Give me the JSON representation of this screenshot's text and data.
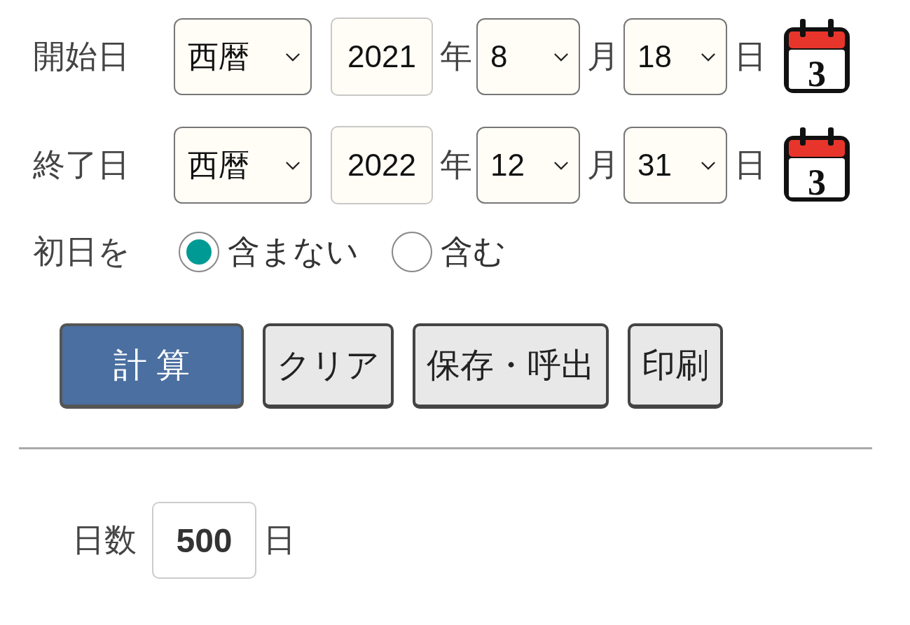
{
  "date_rows": [
    {
      "label": "開始日",
      "era": "西暦",
      "year": "2021",
      "year_unit": "年",
      "month": "8",
      "month_unit": "月",
      "day": "18",
      "day_unit": "日",
      "calendar_day": "3"
    },
    {
      "label": "終了日",
      "era": "西暦",
      "year": "2022",
      "year_unit": "年",
      "month": "12",
      "month_unit": "月",
      "day": "31",
      "day_unit": "日",
      "calendar_day": "3"
    }
  ],
  "first_day": {
    "label": "初日を",
    "options": [
      {
        "label": "含まない",
        "selected": true
      },
      {
        "label": "含む",
        "selected": false
      }
    ]
  },
  "buttons": [
    {
      "label": "計 算",
      "kind": "primary"
    },
    {
      "label": "クリア",
      "kind": "normal"
    },
    {
      "label": "保存・呼出",
      "kind": "normal"
    },
    {
      "label": "印刷",
      "kind": "normal"
    }
  ],
  "result": {
    "label": "日数",
    "value": "500",
    "unit": "日"
  }
}
